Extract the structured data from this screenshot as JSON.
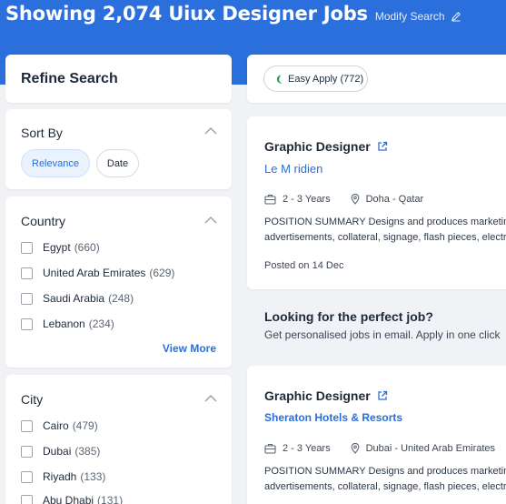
{
  "header": {
    "title": "Showing 2,074 Uiux Designer Jobs",
    "modify_label": "Modify Search"
  },
  "refine": {
    "title": "Refine Search"
  },
  "sort": {
    "title": "Sort By",
    "options": [
      {
        "label": "Relevance",
        "active": true
      },
      {
        "label": "Date",
        "active": false
      }
    ]
  },
  "country": {
    "title": "Country",
    "items": [
      {
        "label": "Egypt",
        "count": "(660)"
      },
      {
        "label": "United Arab Emirates",
        "count": "(629)"
      },
      {
        "label": "Saudi Arabia",
        "count": "(248)"
      },
      {
        "label": "Lebanon",
        "count": "(234)"
      }
    ],
    "view_more": "View More"
  },
  "city": {
    "title": "City",
    "items": [
      {
        "label": "Cairo",
        "count": "(479)"
      },
      {
        "label": "Dubai",
        "count": "(385)"
      },
      {
        "label": "Riyadh",
        "count": "(133)"
      },
      {
        "label": "Abu Dhabi",
        "count": "(131)"
      }
    ]
  },
  "easy_apply": {
    "label": "Easy Apply (772)"
  },
  "jobs": [
    {
      "title": "Graphic Designer",
      "company": "Le M ridien",
      "experience": "2 - 3 Years",
      "location": "Doha - Qatar",
      "desc_line1": "POSITION SUMMARY Designs and produces marketing",
      "desc_line2": "advertisements, collateral, signage, flash pieces, electro",
      "posted": "Posted on 14 Dec"
    },
    {
      "title": "Graphic Designer",
      "company": "Sheraton Hotels & Resorts",
      "experience": "2 - 3 Years",
      "location": "Dubai - United Arab Emirates",
      "desc_line1": "POSITION SUMMARY Designs and produces marketing",
      "desc_line2": "advertisements, collateral, signage, flash pieces, electro"
    }
  ],
  "promo": {
    "title": "Looking for the perfect job?",
    "text": "Get personalised jobs in email. Apply in one click"
  },
  "icons": {
    "edit": "pencil-icon",
    "external": "external-link-icon",
    "chevron": "chevron-up-icon",
    "briefcase": "briefcase-icon",
    "location": "map-pin-icon",
    "easy_apply": "quick-apply-icon"
  },
  "colors": {
    "primary": "#2a6fdb",
    "background": "#f0f2f5",
    "easy_apply_icon": "#1f9d55"
  }
}
